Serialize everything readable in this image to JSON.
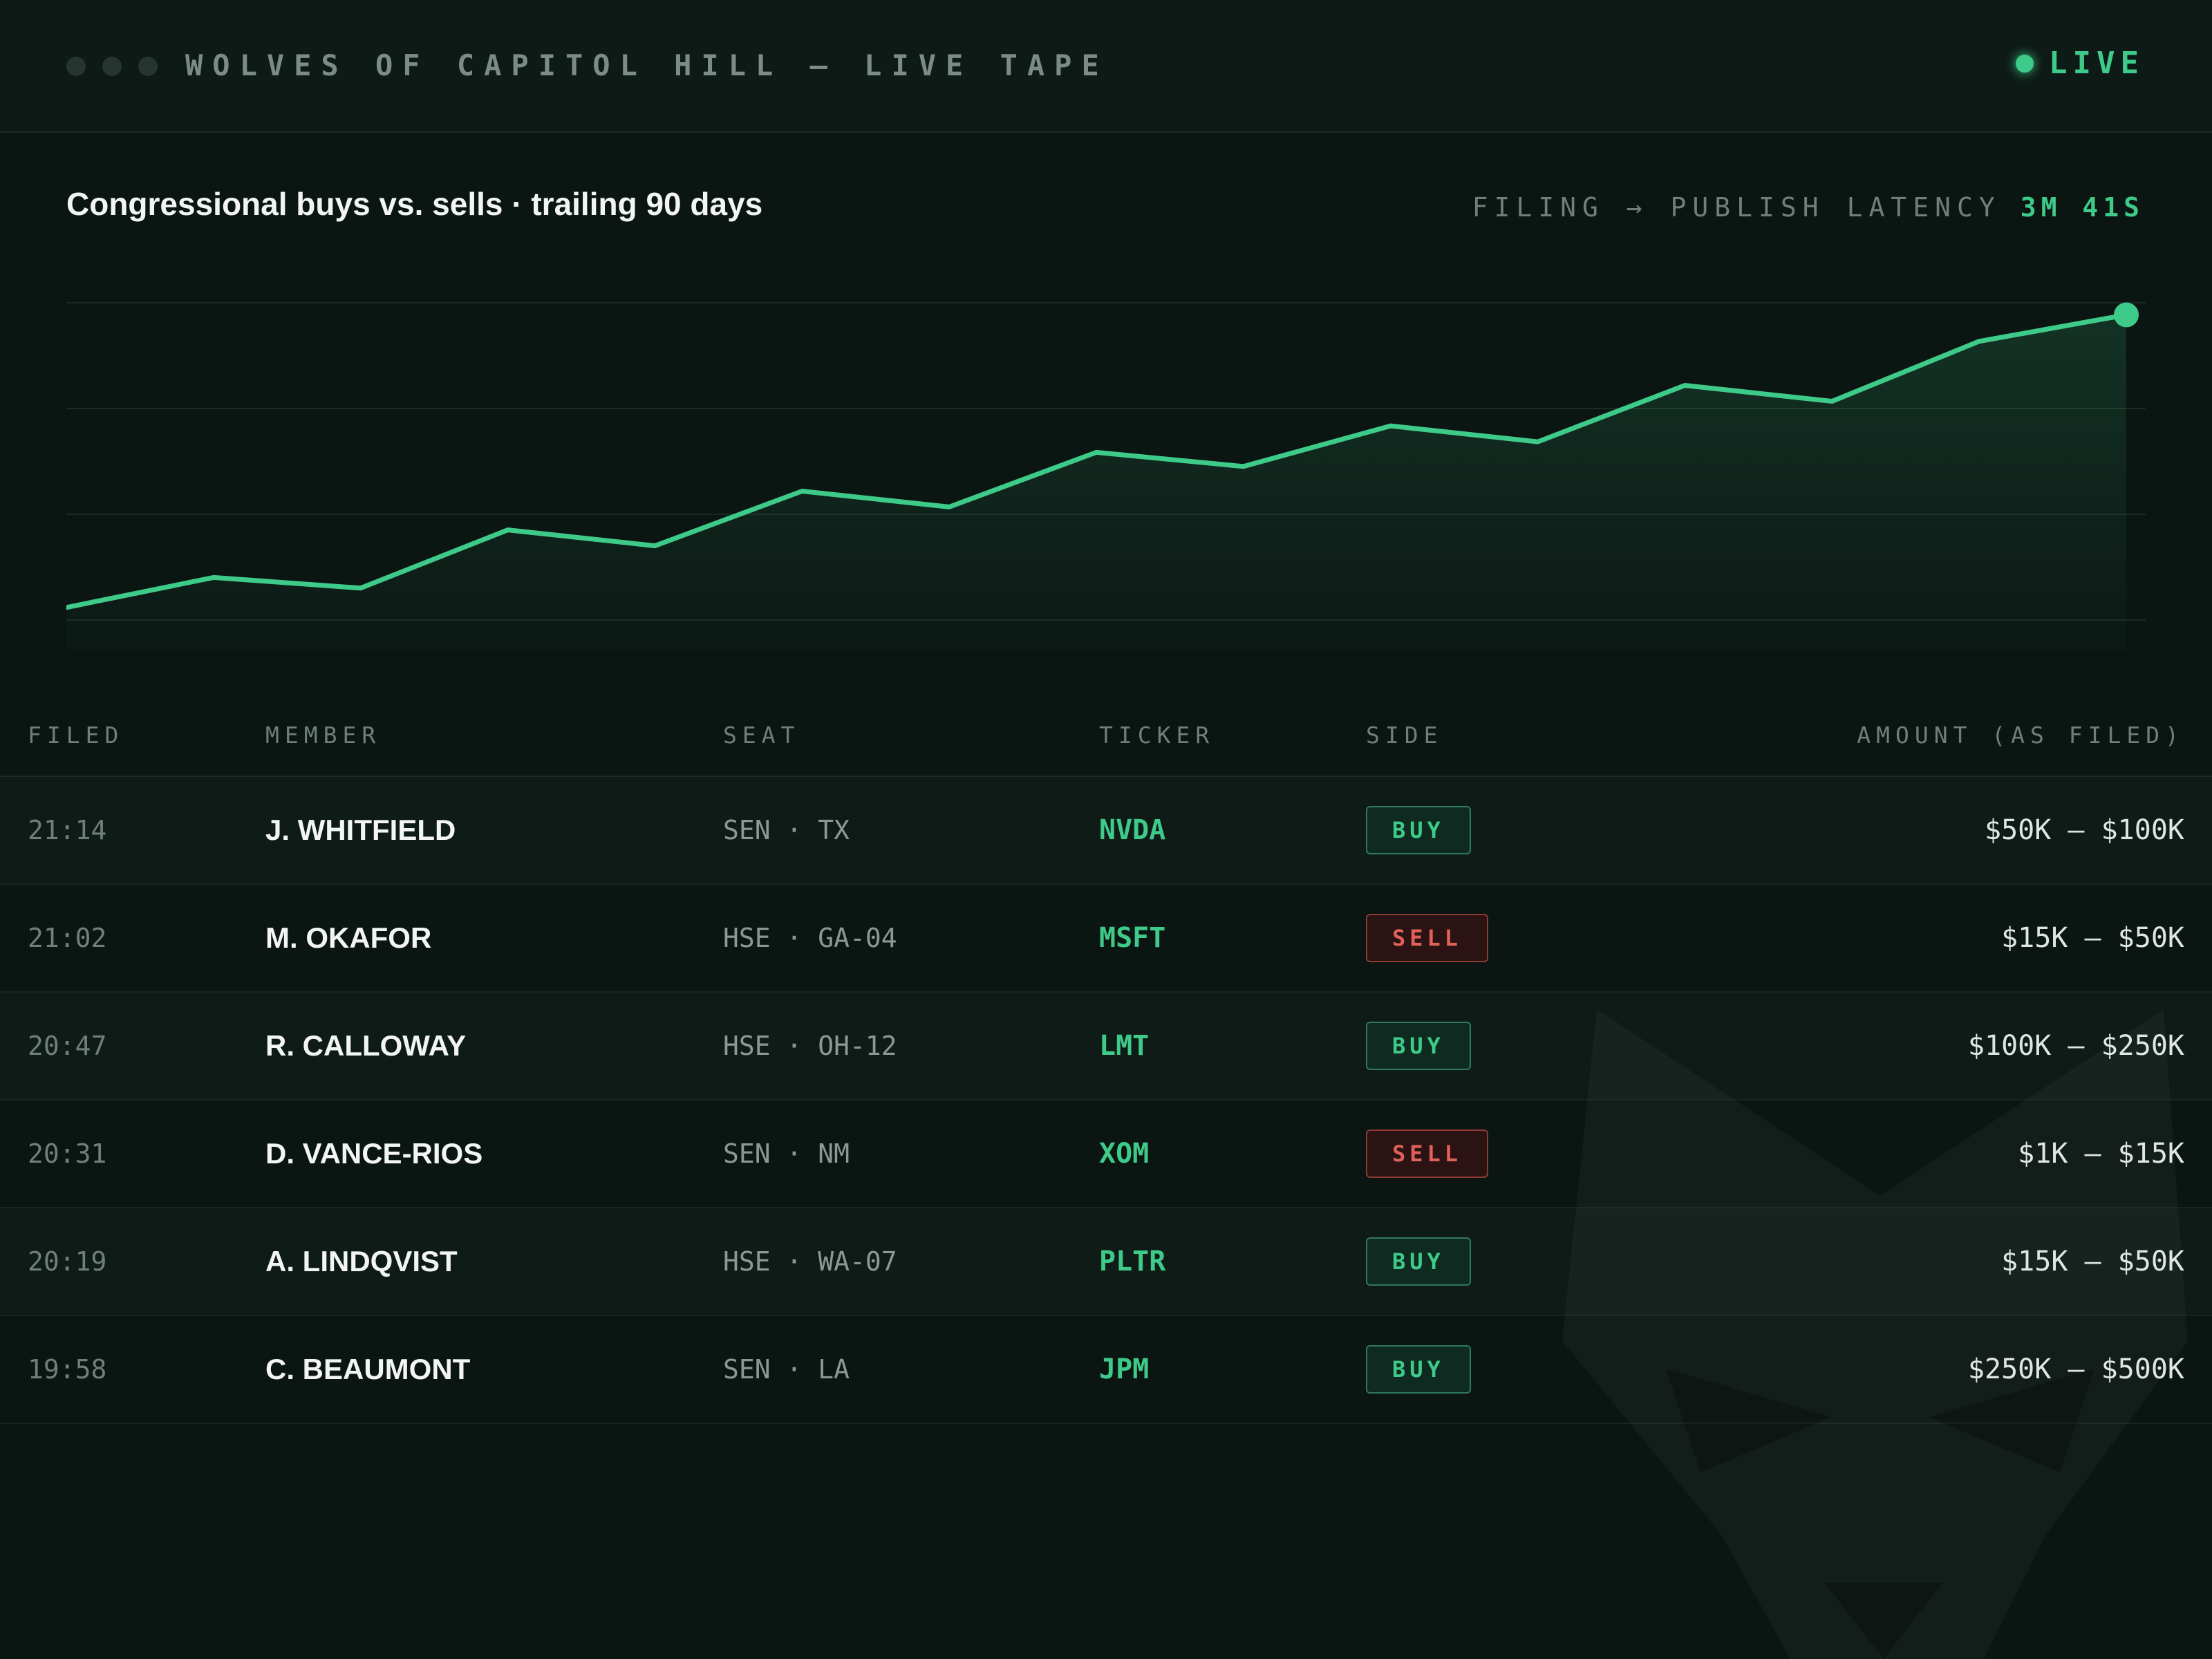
{
  "header": {
    "title": "WOLVES OF CAPITOL HILL — LIVE TAPE",
    "live_label": "LIVE"
  },
  "chart_header": {
    "title": "Congressional buys vs. sells · trailing 90 days",
    "latency_label": "FILING → PUBLISH LATENCY",
    "latency_value": "3M 41S"
  },
  "chart_data": {
    "type": "area",
    "title": "Congressional buys vs. sells · trailing 90 days",
    "x": [
      0,
      1,
      2,
      3,
      4,
      5,
      6,
      7,
      8,
      9,
      10,
      11,
      12,
      13,
      14
    ],
    "values": [
      12,
      20.5,
      17.5,
      34,
      29.5,
      45,
      40.5,
      56,
      52,
      63.5,
      59,
      75,
      70.5,
      87.5,
      95
    ],
    "ylim": [
      0,
      100
    ],
    "grid": true,
    "accent": "#3ecb8a"
  },
  "table": {
    "headers": {
      "filed": "FILED",
      "member": "MEMBER",
      "seat": "SEAT",
      "ticker": "TICKER",
      "side": "SIDE",
      "amount": "AMOUNT (AS FILED)"
    },
    "rows": [
      {
        "filed": "21:14",
        "member": "J. WHITFIELD",
        "seat": "SEN · TX",
        "ticker": "NVDA",
        "side": "BUY",
        "amount": "$50K – $100K"
      },
      {
        "filed": "21:02",
        "member": "M. OKAFOR",
        "seat": "HSE · GA-04",
        "ticker": "MSFT",
        "side": "SELL",
        "amount": "$15K – $50K"
      },
      {
        "filed": "20:47",
        "member": "R. CALLOWAY",
        "seat": "HSE · OH-12",
        "ticker": "LMT",
        "side": "BUY",
        "amount": "$100K – $250K"
      },
      {
        "filed": "20:31",
        "member": "D. VANCE-RIOS",
        "seat": "SEN · NM",
        "ticker": "XOM",
        "side": "SELL",
        "amount": "$1K – $15K"
      },
      {
        "filed": "20:19",
        "member": "A. LINDQVIST",
        "seat": "HSE · WA-07",
        "ticker": "PLTR",
        "side": "BUY",
        "amount": "$15K – $50K"
      },
      {
        "filed": "19:58",
        "member": "C. BEAUMONT",
        "seat": "SEN · LA",
        "ticker": "JPM",
        "side": "BUY",
        "amount": "$250K – $500K"
      }
    ]
  },
  "colors": {
    "background": "#0b1512",
    "accent_green": "#3ecb8a",
    "sell_red": "#e0605a",
    "header_text": "#7a8c85"
  },
  "icons": {
    "window_dots": "window-control-dots",
    "watermark": "wolf-logo-icon"
  }
}
